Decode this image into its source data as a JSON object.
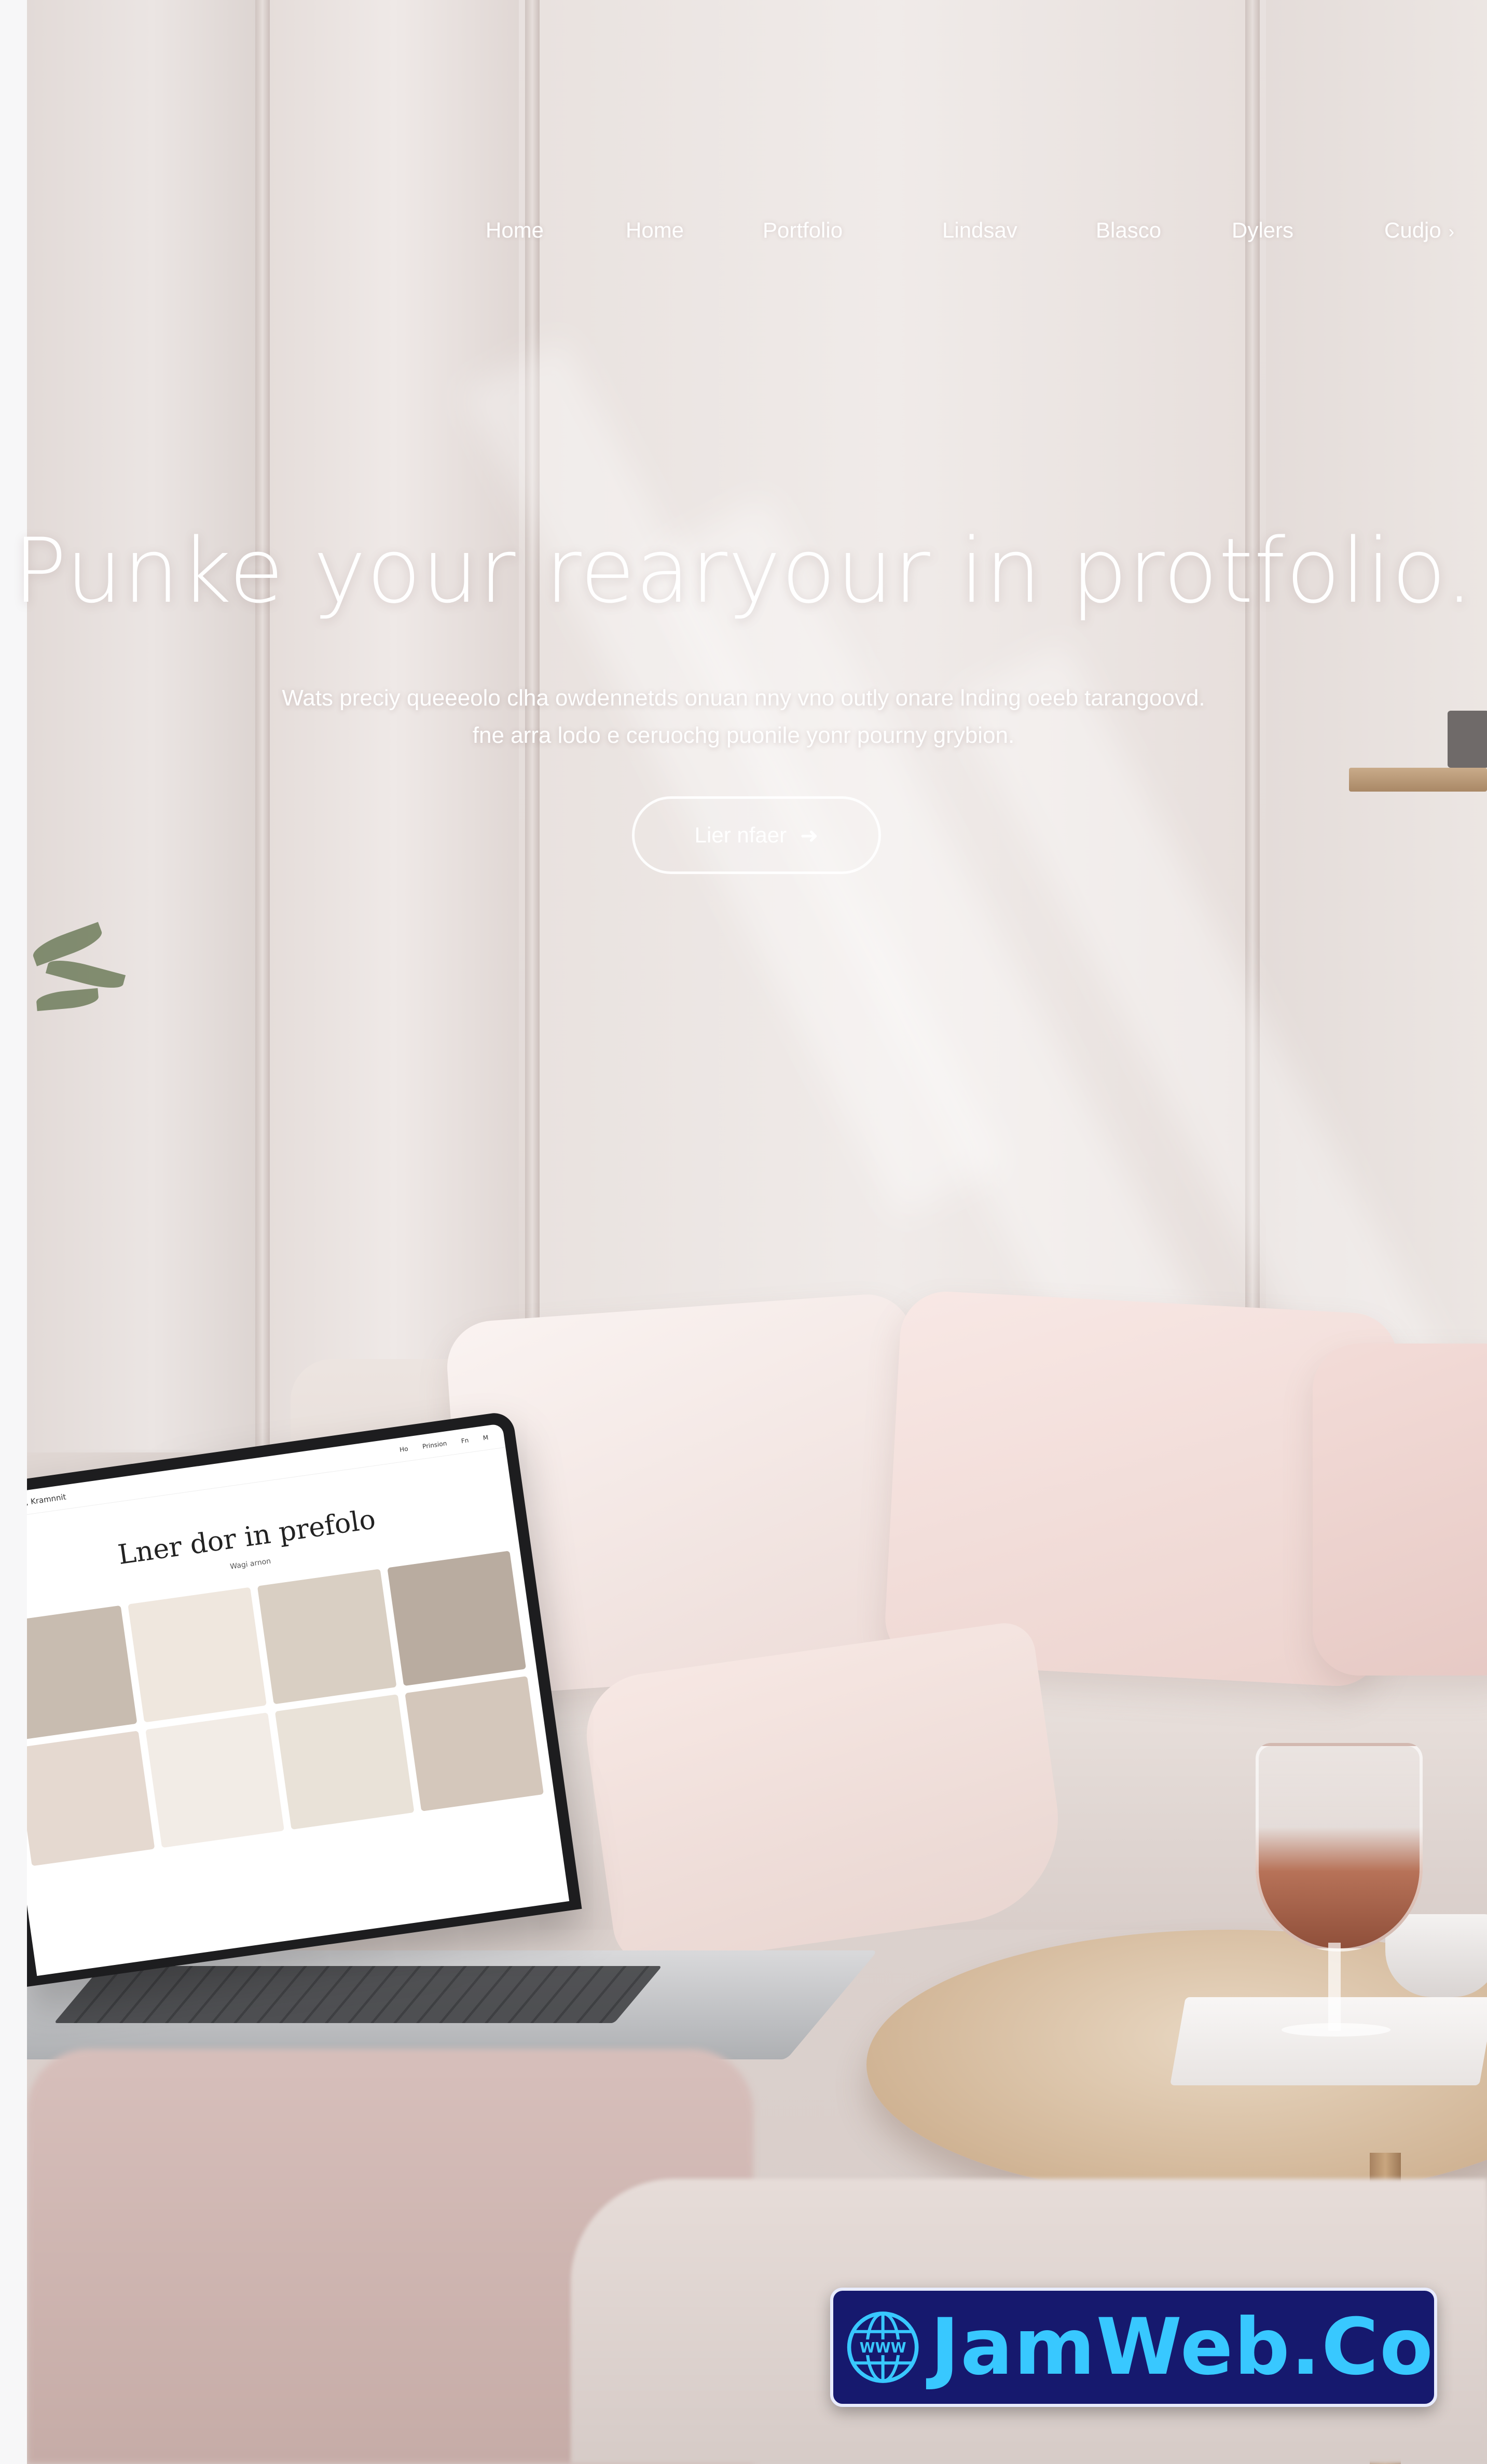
{
  "nav": {
    "items": [
      "Home",
      "Home",
      "Portfolio",
      "Lindsav",
      "Blasco",
      "Dylers",
      "Cudjo"
    ]
  },
  "hero": {
    "title": "Punke your rearyour in protfolio.",
    "subtitle_line1": "Wats preciy queeeolo clha owdennetds onuan nny vno outly onare lnding oeeb tarangoovd.",
    "subtitle_line2": "fne arra lodo e ceruochg puonile yonr pourny grybion.",
    "cta_label": "Lier nfaer",
    "cta_icon": "arrow-right-icon"
  },
  "laptop": {
    "nav_brand": "Ciro Mahd, Kramnnit",
    "nav_links": [
      "Ho",
      "Prinsion",
      "Fn",
      "M"
    ],
    "title": "Lner dor in prefolo",
    "subtitle": "Wagi arnon",
    "tile_colors": [
      "#c8bcb0",
      "#efe7de",
      "#d9cfc3",
      "#b9aca0",
      "#e5d9d0",
      "#f2ece6",
      "#e9e2d8",
      "#d4c7bb"
    ]
  },
  "badge": {
    "globe_label": "WWW",
    "text": "JamWeb.Co"
  },
  "colors": {
    "badge_bg": "#16196e",
    "badge_text": "#38c8ff"
  }
}
